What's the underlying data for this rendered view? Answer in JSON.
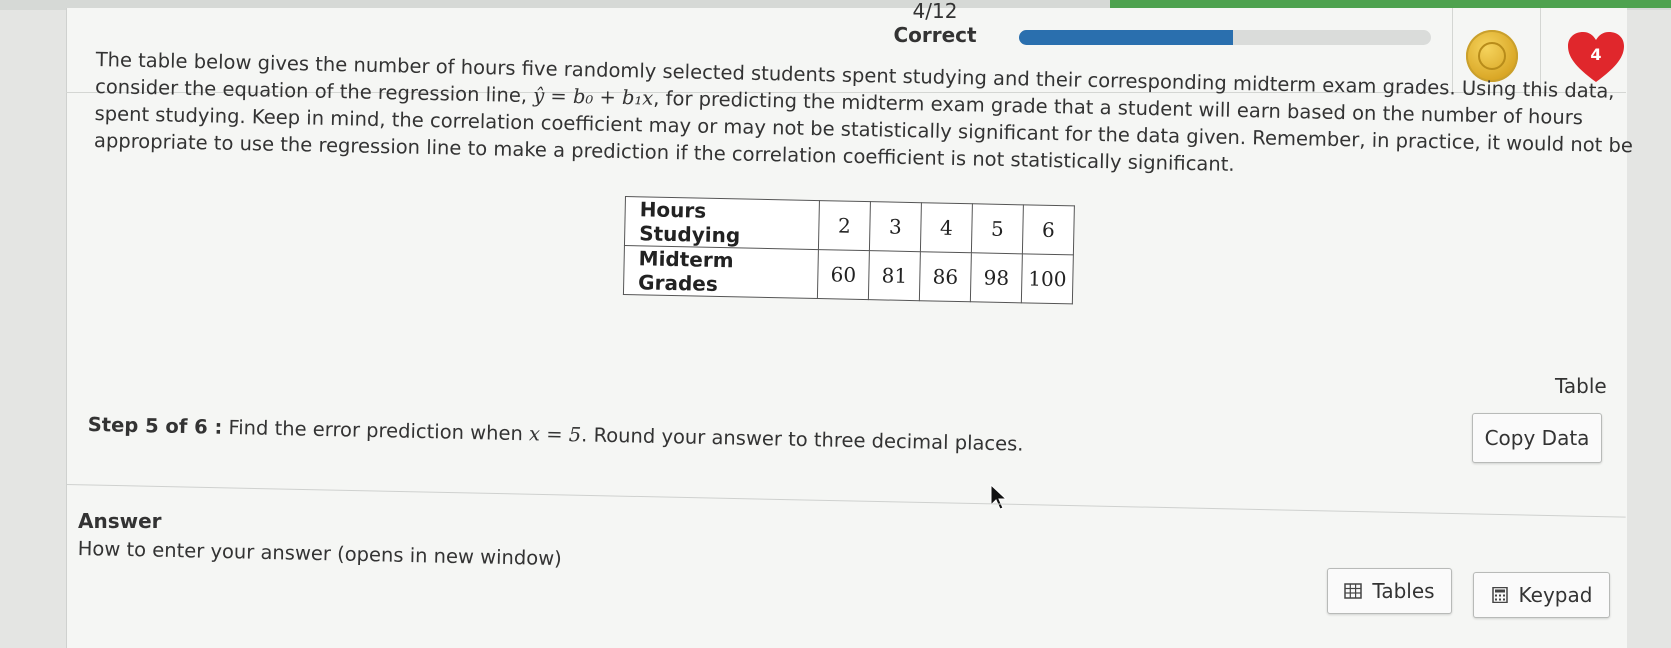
{
  "header": {
    "progress_count": "4/12",
    "progress_status": "Correct",
    "progress_fraction": 0.52,
    "heart_count": "4",
    "accent_color": "#2a6fae"
  },
  "problem": {
    "p1": "The table below gives the number of hours five randomly selected students spent studying and their corresponding midterm exam grades. Using this data, consider the equation of the regression line, ",
    "equation": "ŷ = b₀ + b₁x",
    "p2": ", for predicting the midterm exam grade that a student will earn based on the number of hours spent studying. Keep in mind, the correlation coefficient may or may not be statistically significant for the data given. Remember, in practice, it would not be appropriate to use the regression line to make a prediction if the correlation coefficient is not statistically significant."
  },
  "data_table": {
    "rows": [
      {
        "label": "Hours Studying",
        "values": [
          "2",
          "3",
          "4",
          "5",
          "6"
        ]
      },
      {
        "label": "Midterm Grades",
        "values": [
          "60",
          "81",
          "86",
          "98",
          "100"
        ]
      }
    ]
  },
  "side": {
    "table_label": "Table",
    "copy_data": "Copy Data"
  },
  "step": {
    "label": "Step 5 of 6 :",
    "text1": " Find the error prediction when ",
    "math": "x = 5",
    "text2": ". Round your answer to three decimal places."
  },
  "answer": {
    "heading": "Answer",
    "howto": "How to enter your answer (opens in new window)",
    "tables_btn": "Tables",
    "keypad_btn": "Keypad"
  }
}
